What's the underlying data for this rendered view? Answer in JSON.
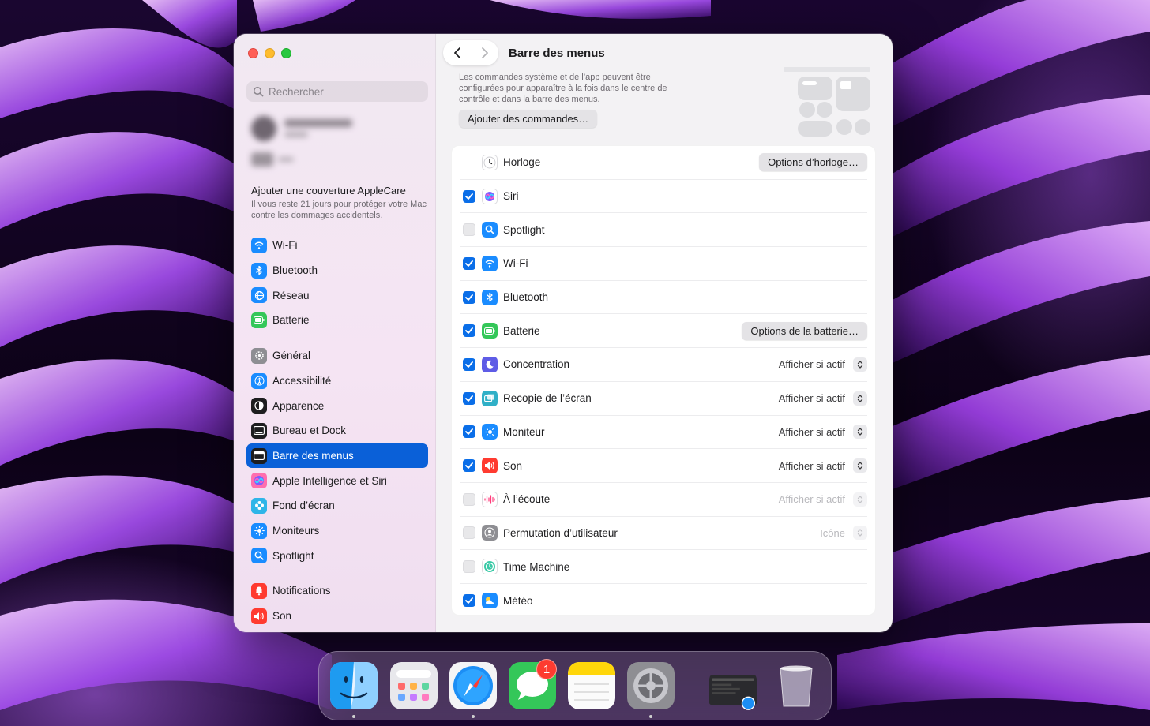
{
  "window": {
    "title": "Barre des menus",
    "back_icon": "chevron-left-icon",
    "forward_icon": "chevron-right-icon"
  },
  "sidebar": {
    "search_placeholder": "Rechercher",
    "applecare": {
      "title": "Ajouter une couverture AppleCare",
      "subtitle": "Il vous reste 21 jours pour protéger votre Mac contre les dommages accidentels."
    },
    "groups": [
      [
        {
          "label": "Wi-Fi",
          "icon": "wifi-icon",
          "color": "#1a8cff"
        },
        {
          "label": "Bluetooth",
          "icon": "bluetooth-icon",
          "color": "#1a8cff"
        },
        {
          "label": "Réseau",
          "icon": "globe-icon",
          "color": "#1a8cff"
        },
        {
          "label": "Batterie",
          "icon": "battery-icon",
          "color": "#34c759"
        }
      ],
      [
        {
          "label": "Général",
          "icon": "gear-icon",
          "color": "#8e8e93"
        },
        {
          "label": "Accessibilité",
          "icon": "accessibility-icon",
          "color": "#1a8cff"
        },
        {
          "label": "Apparence",
          "icon": "appearance-icon",
          "color": "#1d1d1f"
        },
        {
          "label": "Bureau et Dock",
          "icon": "dock-icon",
          "color": "#1d1d1f"
        },
        {
          "label": "Barre des menus",
          "icon": "menubar-icon",
          "color": "#1d1d1f",
          "active": true
        },
        {
          "label": "Apple Intelligence et Siri",
          "icon": "siri-icon",
          "color": "#ff6fae"
        },
        {
          "label": "Fond d’écran",
          "icon": "wallpaper-icon",
          "color": "#2fb5e8"
        },
        {
          "label": "Moniteurs",
          "icon": "sun-icon",
          "color": "#1a8cff"
        },
        {
          "label": "Spotlight",
          "icon": "magnifier-icon",
          "color": "#1a8cff"
        }
      ],
      [
        {
          "label": "Notifications",
          "icon": "bell-icon",
          "color": "#ff3b30"
        },
        {
          "label": "Son",
          "icon": "speaker-icon",
          "color": "#ff3b30"
        }
      ]
    ]
  },
  "main": {
    "intro_text": "Les commandes système et de l’app peuvent être configurées pour apparaître à la fois dans le centre de contrôle et dans la barre des menus.",
    "add_button": "Ajouter des commandes…",
    "rows": [
      {
        "label": "Horloge",
        "icon": "clock-icon",
        "color": "#ffffff",
        "check": "none",
        "button": "Options d’horloge…"
      },
      {
        "label": "Siri",
        "icon": "siri-icon",
        "color": "#ffffff",
        "check": "on"
      },
      {
        "label": "Spotlight",
        "icon": "magnifier-icon",
        "color": "#1a8cff",
        "check": "off"
      },
      {
        "label": "Wi-Fi",
        "icon": "wifi-icon",
        "color": "#1a8cff",
        "check": "on"
      },
      {
        "label": "Bluetooth",
        "icon": "bluetooth-icon",
        "color": "#1a8cff",
        "check": "on"
      },
      {
        "label": "Batterie",
        "icon": "battery-icon",
        "color": "#34c759",
        "check": "on",
        "button": "Options de la batterie…"
      },
      {
        "label": "Concentration",
        "icon": "moon-icon",
        "color": "#5e5ce6",
        "check": "on",
        "select": "Afficher si actif"
      },
      {
        "label": "Recopie de l’écran",
        "icon": "screen-mirroring-icon",
        "color": "#30b0c7",
        "check": "on",
        "select": "Afficher si actif"
      },
      {
        "label": "Moniteur",
        "icon": "sun-icon",
        "color": "#1a8cff",
        "check": "on",
        "select": "Afficher si actif"
      },
      {
        "label": "Son",
        "icon": "speaker-icon",
        "color": "#ff3b30",
        "check": "on",
        "select": "Afficher si actif"
      },
      {
        "label": "À l’écoute",
        "icon": "waveform-icon",
        "color": "#ffffff",
        "check": "off",
        "select": "Afficher si actif",
        "dim": true
      },
      {
        "label": "Permutation d’utilisateur",
        "icon": "user-switch-icon",
        "color": "#8e8e93",
        "check": "off",
        "select": "Icône",
        "dim": true
      },
      {
        "label": "Time Machine",
        "icon": "time-machine-icon",
        "color": "#ffffff",
        "check": "off"
      },
      {
        "label": "Météo",
        "icon": "weather-icon",
        "color": "#1a8cff",
        "check": "on"
      }
    ]
  },
  "dock": {
    "apps": [
      {
        "name": "Finder",
        "icon": "finder-icon",
        "running": true
      },
      {
        "name": "Launchpad",
        "icon": "launchpad-icon",
        "running": false
      },
      {
        "name": "Safari",
        "icon": "safari-icon",
        "running": true
      },
      {
        "name": "Messages",
        "icon": "messages-icon",
        "running": false,
        "badge": "1"
      },
      {
        "name": "Notes",
        "icon": "notes-icon",
        "running": false
      },
      {
        "name": "Réglages Système",
        "icon": "system-settings-icon",
        "running": true
      },
      {
        "name": "Safari window",
        "icon": "minimized-window-icon",
        "running": false
      },
      {
        "name": "Corbeille",
        "icon": "trash-icon",
        "running": false
      }
    ]
  }
}
